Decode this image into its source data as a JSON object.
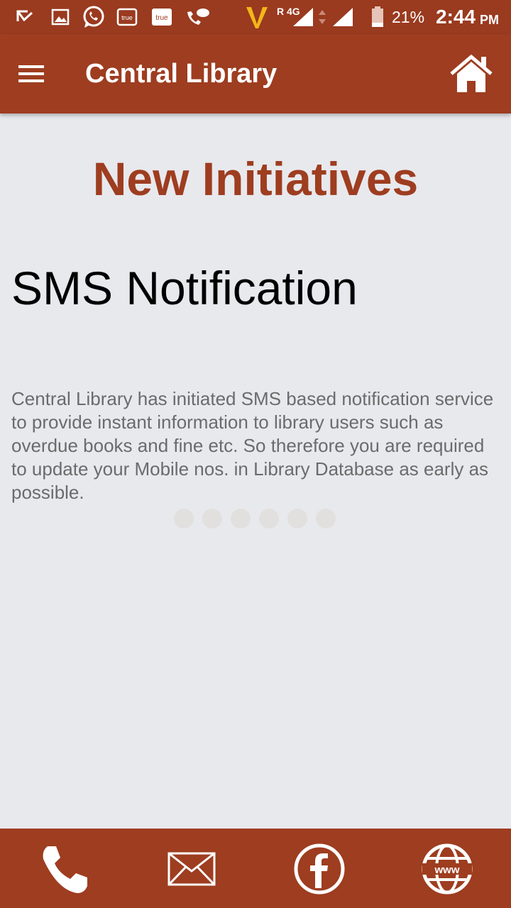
{
  "status_bar": {
    "icons": [
      "missed-call-icon",
      "image-icon",
      "whatsapp-icon",
      "truecaller-icon",
      "truecaller-icon",
      "wifi-call-icon",
      "vodafone-icon",
      "signal-icon",
      "battery-icon"
    ],
    "network_label": "R 4G",
    "battery": "21%",
    "time": "2:44",
    "ampm": "PM"
  },
  "app_bar": {
    "title": "Central Library",
    "menu_icon": "hamburger-menu-icon",
    "home_icon": "home-icon"
  },
  "page": {
    "heading": "New Initiatives",
    "slide": {
      "title": "SMS Notification",
      "body": "Central Library has initiated SMS based notification service to provide instant information to library users such as overdue books and fine etc. So therefore you are required to update your Mobile nos. in Library Database as early as possible."
    },
    "pager": {
      "count": 6
    }
  },
  "bottom_bar": {
    "items": [
      "phone-icon",
      "email-icon",
      "facebook-icon",
      "website-icon"
    ]
  },
  "colors": {
    "primary": "#9e3d20",
    "background": "#e8e9ed",
    "body_text": "#6b6b6b"
  }
}
